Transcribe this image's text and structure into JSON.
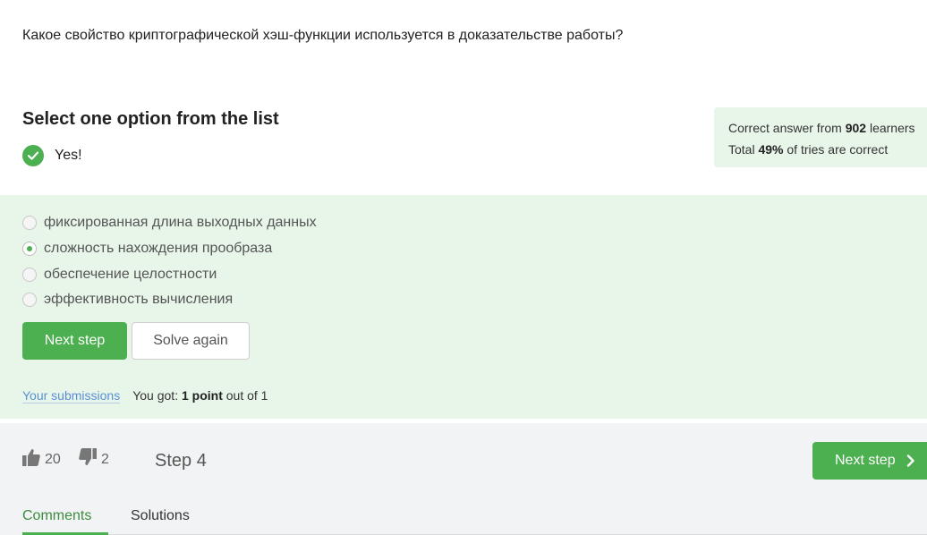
{
  "question": {
    "text": "Какое свойство криптографической хэш-функции используется в доказательстве работы?"
  },
  "quiz": {
    "instruction": "Select one option from the list",
    "result_label": "Yes!",
    "stats": {
      "line1_prefix": "Correct answer from",
      "learners_count": "902",
      "line1_suffix": "learners",
      "line2_prefix": "Total",
      "percent": "49%",
      "line2_suffix": "of tries are correct"
    },
    "options": [
      {
        "label": "фиксированная длина выходных данных",
        "selected": false
      },
      {
        "label": "сложность нахождения прообраза",
        "selected": true
      },
      {
        "label": "обеспечение целостности",
        "selected": false
      },
      {
        "label": "эффективность вычисления",
        "selected": false
      }
    ],
    "buttons": {
      "next_step": "Next step",
      "solve_again": "Solve again"
    },
    "submissions_link": "Your submissions",
    "score": {
      "prefix": "You got:",
      "points": "1 point",
      "suffix": "out of 1"
    }
  },
  "footer": {
    "likes": "20",
    "dislikes": "2",
    "step_label": "Step 4",
    "next_step": "Next step",
    "tabs": [
      "Comments",
      "Solutions"
    ],
    "active_tab": "Comments"
  },
  "colors": {
    "accent": "#4caf50",
    "panel_bg": "#e8f5e9",
    "link": "#5a8fd8",
    "footer_bg": "#f2f3f5"
  },
  "icons": [
    "checkmark-icon",
    "thumbs-up-icon",
    "thumbs-down-icon",
    "chevron-right-icon"
  ]
}
